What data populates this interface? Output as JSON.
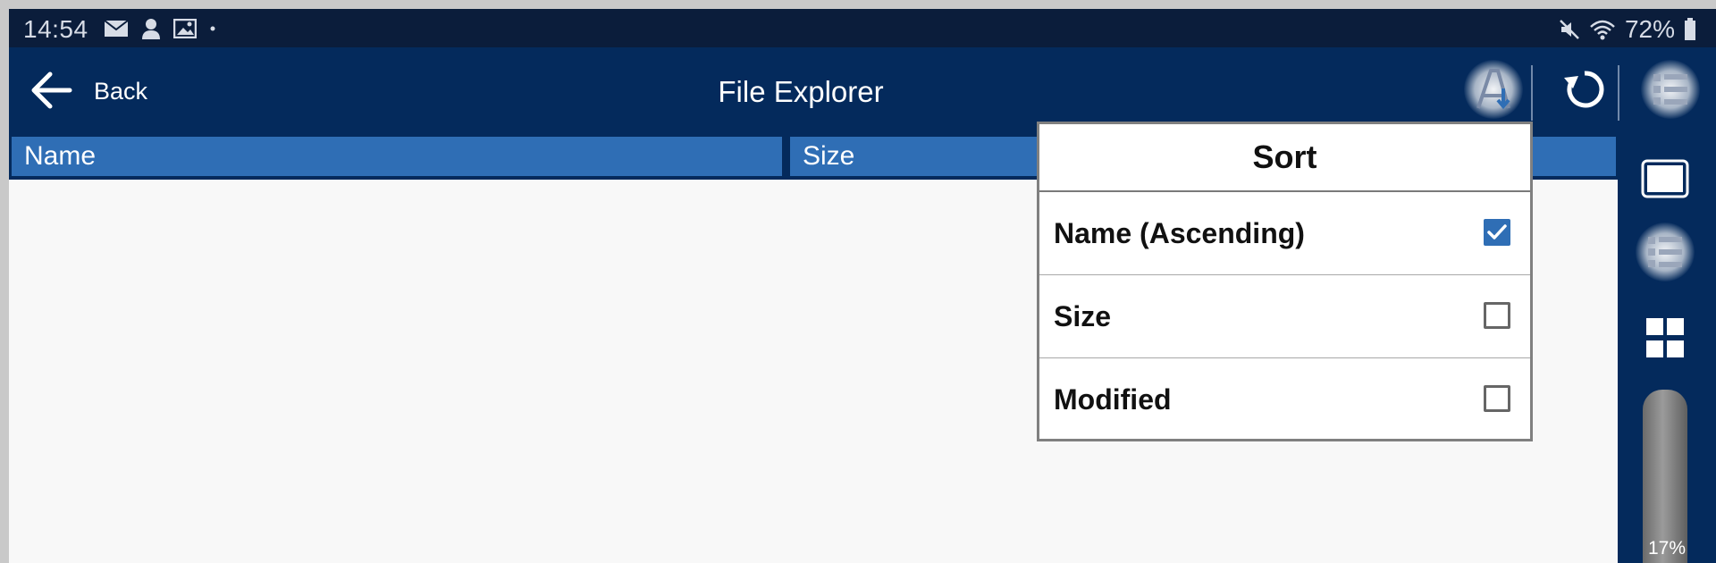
{
  "status_bar": {
    "time": "14:54",
    "battery": "72%",
    "icons": [
      "mail-icon",
      "person-icon",
      "image-icon",
      "dot-icon",
      "mute-icon",
      "wifi-icon",
      "battery-icon"
    ]
  },
  "app_bar": {
    "back_label": "Back",
    "title": "File Explorer",
    "actions": [
      "sort-icon",
      "refresh-icon",
      "list-view-icon"
    ]
  },
  "table": {
    "columns": [
      "Name",
      "Size"
    ]
  },
  "side_panel": {
    "buttons": [
      "single-view-icon",
      "list-view-icon",
      "grid-view-icon"
    ],
    "slider_value": "17%"
  },
  "sort_menu": {
    "title": "Sort",
    "options": [
      {
        "label": "Name (Ascending)",
        "checked": true
      },
      {
        "label": "Size",
        "checked": false
      },
      {
        "label": "Modified",
        "checked": false
      }
    ]
  },
  "colors": {
    "status_bar": "#0b1d3b",
    "app_bar": "#042a5c",
    "header_cell": "#2f6eb5",
    "checkbox_on": "#2f6eb5"
  }
}
